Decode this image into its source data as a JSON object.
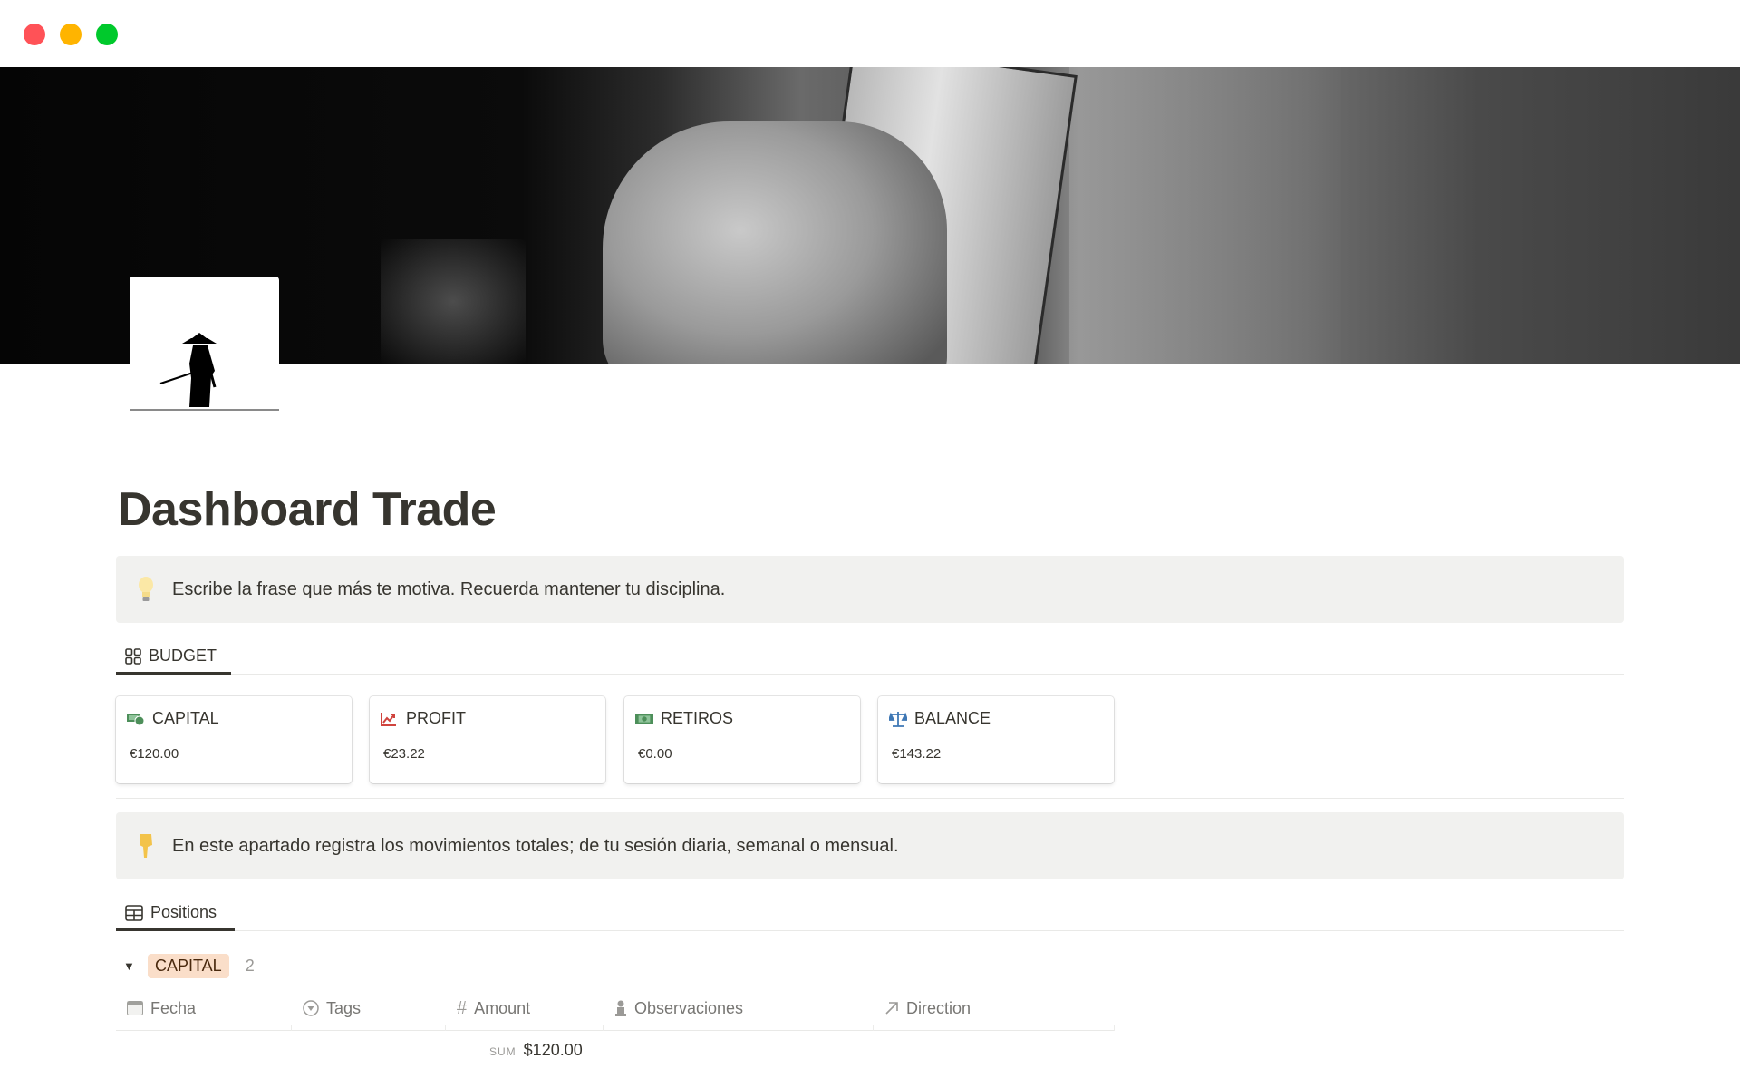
{
  "window": {
    "controls": [
      "close",
      "minimize",
      "maximize"
    ]
  },
  "page": {
    "title": "Dashboard Trade",
    "icon": "samurai-silhouette-icon",
    "cover": "hand-holding-dollar-bill-photo"
  },
  "callouts": [
    {
      "emoji": "lightbulb-icon",
      "text": "Escribe la frase que más te motiva. Recuerda mantener tu disciplina."
    },
    {
      "emoji": "pointing-down-icon",
      "text": "En este apartado registra los movimientos totales; de tu sesión diaria, semanal o mensual."
    }
  ],
  "budget": {
    "tab_label": "BUDGET",
    "tab_icon": "gallery-icon",
    "cards": [
      {
        "title": "CAPITAL",
        "icon": "money-with-coin-icon",
        "value": "€120.00"
      },
      {
        "title": "PROFIT",
        "icon": "chart-increasing-icon",
        "value": "€23.22"
      },
      {
        "title": "RETIROS",
        "icon": "banknote-icon",
        "value": "€0.00"
      },
      {
        "title": "BALANCE",
        "icon": "scales-icon",
        "value": "€143.22"
      }
    ]
  },
  "positions": {
    "tab_label": "Positions",
    "tab_icon": "table-icon",
    "group": {
      "label": "CAPITAL",
      "count": "2",
      "color": "#fadec9"
    },
    "columns": [
      {
        "label": "Fecha",
        "icon": "calendar-icon"
      },
      {
        "label": "Tags",
        "icon": "select-icon"
      },
      {
        "label": "Amount",
        "icon": "number-icon"
      },
      {
        "label": "Observaciones",
        "icon": "person-icon"
      },
      {
        "label": "Direction",
        "icon": "relation-arrow-icon"
      }
    ],
    "summary": {
      "label": "SUM",
      "value": "$120.00"
    }
  }
}
